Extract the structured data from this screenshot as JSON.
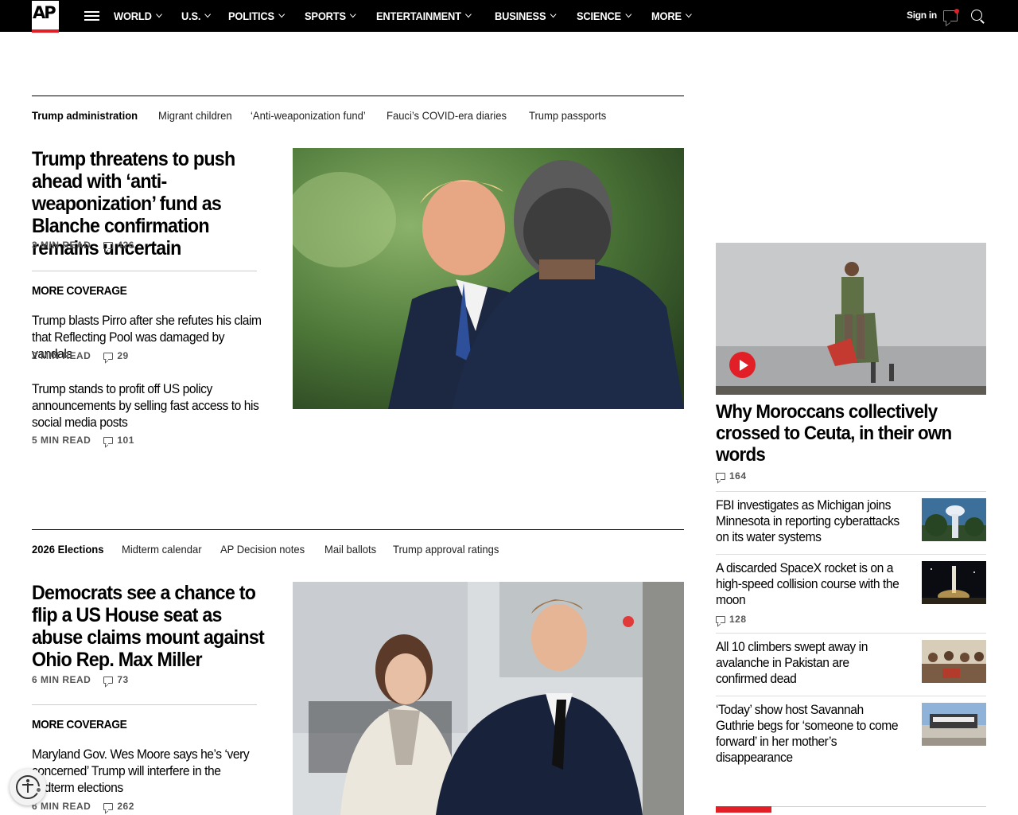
{
  "brand": {
    "logo_text": "AP",
    "accent": "#e21f26"
  },
  "nav": {
    "items": [
      "WORLD",
      "U.S.",
      "POLITICS",
      "SPORTS",
      "ENTERTAINMENT",
      "BUSINESS",
      "SCIENCE",
      "MORE"
    ],
    "signin": "Sign in"
  },
  "section1": {
    "tags": [
      "Trump administration",
      "Migrant children",
      "‘Anti-weaponization fund’",
      "Fauci’s COVID-era diaries",
      "Trump passports"
    ],
    "headline": "Trump threatens to push ahead with ‘anti-weaponization’ fund as Blanche confirmation remains uncertain",
    "read": "3 MIN READ",
    "comments": "426",
    "more_coverage": "MORE COVERAGE",
    "subs": [
      {
        "title": "Trump blasts Pirro after she refutes his claim that Reflecting Pool was damaged by vandals",
        "read": "2 MIN READ",
        "comments": "29"
      },
      {
        "title": "Trump stands to profit off US policy announcements by selling fast access to his social media posts",
        "read": "5 MIN READ",
        "comments": "101"
      }
    ]
  },
  "section2": {
    "tags": [
      "2026 Elections",
      "Midterm calendar",
      "AP Decision notes",
      "Mail ballots",
      "Trump approval ratings"
    ],
    "headline": "Democrats see a chance to flip a US House seat as abuse claims mount against Ohio Rep. Max Miller",
    "read": "6 MIN READ",
    "comments": "73",
    "more_coverage": "MORE COVERAGE",
    "subs": [
      {
        "title": "Maryland Gov. Wes Moore says he’s ‘very concerned’ Trump will interfere in the midterm elections",
        "read": "6 MIN READ",
        "comments": "262"
      }
    ]
  },
  "rail": {
    "lead": {
      "title": "Why Moroccans collectively crossed to Ceuta, in their own words",
      "comments": "164"
    },
    "items": [
      {
        "title": "FBI investigates as Michigan joins Minnesota in reporting cyberattacks on its water systems",
        "comments": ""
      },
      {
        "title": "A discarded SpaceX rocket is on a high-speed collision course with the moon",
        "comments": "128"
      },
      {
        "title": "All 10 climbers swept away in avalanche in Pakistan are confirmed dead",
        "comments": ""
      },
      {
        "title": "‘Today’ show host Savannah Guthrie begs for ‘someone to come forward’ in her mother’s disappearance",
        "comments": ""
      }
    ]
  }
}
